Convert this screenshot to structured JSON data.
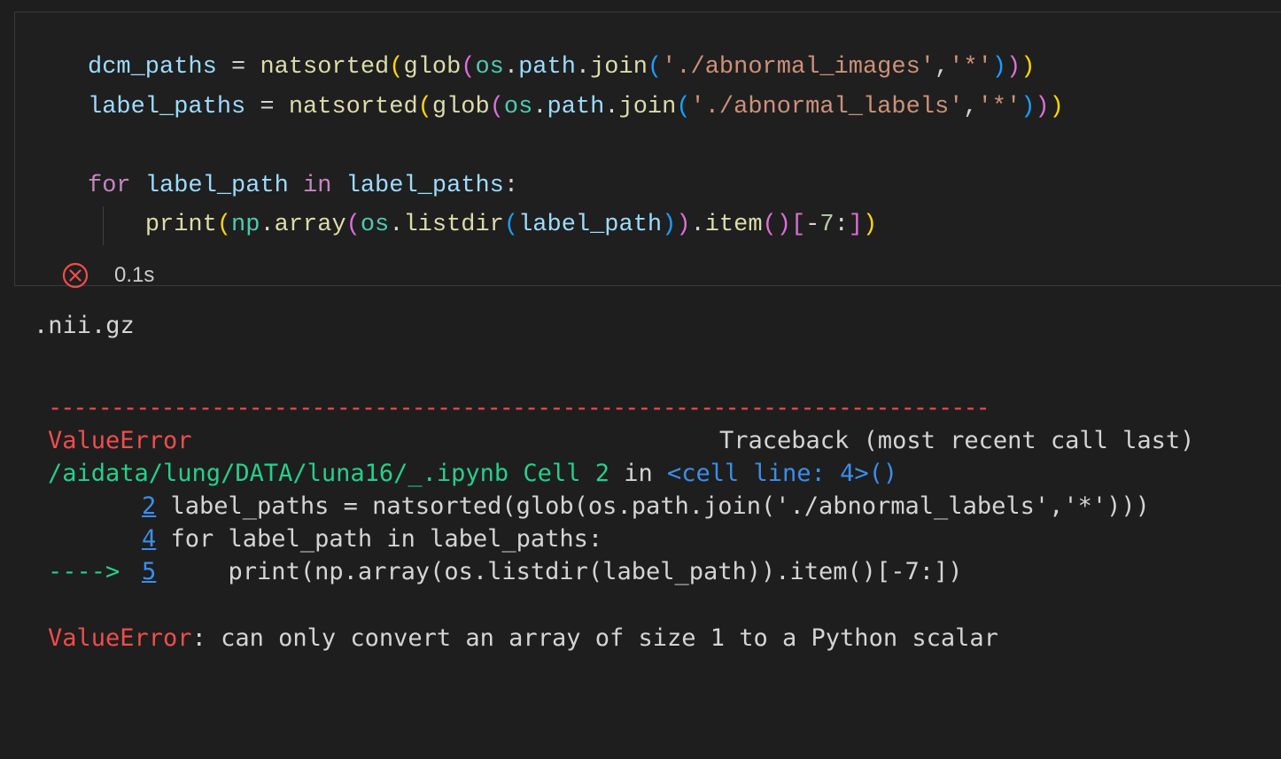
{
  "cell": {
    "code_lines": [
      {
        "tokens": [
          {
            "t": "dcm_paths",
            "c": "var"
          },
          {
            "t": " = ",
            "c": "op"
          },
          {
            "t": "natsorted",
            "c": "fn"
          },
          {
            "t": "(",
            "c": "b1"
          },
          {
            "t": "glob",
            "c": "fn"
          },
          {
            "t": "(",
            "c": "b2"
          },
          {
            "t": "os",
            "c": "mod"
          },
          {
            "t": ".",
            "c": "op"
          },
          {
            "t": "path",
            "c": "var"
          },
          {
            "t": ".",
            "c": "op"
          },
          {
            "t": "join",
            "c": "fn"
          },
          {
            "t": "(",
            "c": "b3"
          },
          {
            "t": "'./abnormal_images'",
            "c": "str"
          },
          {
            "t": ",",
            "c": "op"
          },
          {
            "t": "'*'",
            "c": "str"
          },
          {
            "t": ")",
            "c": "b3"
          },
          {
            "t": ")",
            "c": "b2"
          },
          {
            "t": ")",
            "c": "b1"
          }
        ]
      },
      {
        "tokens": [
          {
            "t": "label_paths",
            "c": "var"
          },
          {
            "t": " = ",
            "c": "op"
          },
          {
            "t": "natsorted",
            "c": "fn"
          },
          {
            "t": "(",
            "c": "b1"
          },
          {
            "t": "glob",
            "c": "fn"
          },
          {
            "t": "(",
            "c": "b2"
          },
          {
            "t": "os",
            "c": "mod"
          },
          {
            "t": ".",
            "c": "op"
          },
          {
            "t": "path",
            "c": "var"
          },
          {
            "t": ".",
            "c": "op"
          },
          {
            "t": "join",
            "c": "fn"
          },
          {
            "t": "(",
            "c": "b3"
          },
          {
            "t": "'./abnormal_labels'",
            "c": "str"
          },
          {
            "t": ",",
            "c": "op"
          },
          {
            "t": "'*'",
            "c": "str"
          },
          {
            "t": ")",
            "c": "b3"
          },
          {
            "t": ")",
            "c": "b2"
          },
          {
            "t": ")",
            "c": "b1"
          }
        ]
      },
      {
        "tokens": []
      },
      {
        "tokens": [
          {
            "t": "for",
            "c": "kw"
          },
          {
            "t": " ",
            "c": "op"
          },
          {
            "t": "label_path",
            "c": "var"
          },
          {
            "t": " ",
            "c": "op"
          },
          {
            "t": "in",
            "c": "kw"
          },
          {
            "t": " ",
            "c": "op"
          },
          {
            "t": "label_paths",
            "c": "var"
          },
          {
            "t": ":",
            "c": "op"
          }
        ]
      },
      {
        "tokens": [
          {
            "t": "    ",
            "c": "op"
          },
          {
            "t": "print",
            "c": "fn"
          },
          {
            "t": "(",
            "c": "b1"
          },
          {
            "t": "np",
            "c": "mod"
          },
          {
            "t": ".",
            "c": "op"
          },
          {
            "t": "array",
            "c": "fn"
          },
          {
            "t": "(",
            "c": "b2"
          },
          {
            "t": "os",
            "c": "mod"
          },
          {
            "t": ".",
            "c": "op"
          },
          {
            "t": "listdir",
            "c": "fn"
          },
          {
            "t": "(",
            "c": "b3"
          },
          {
            "t": "label_path",
            "c": "var"
          },
          {
            "t": ")",
            "c": "b3"
          },
          {
            "t": ")",
            "c": "b2"
          },
          {
            "t": ".",
            "c": "op"
          },
          {
            "t": "item",
            "c": "fn"
          },
          {
            "t": "(",
            "c": "b2"
          },
          {
            "t": ")",
            "c": "b2"
          },
          {
            "t": "[",
            "c": "b2"
          },
          {
            "t": "-",
            "c": "op"
          },
          {
            "t": "7",
            "c": "num"
          },
          {
            "t": ":",
            "c": "op"
          },
          {
            "t": "]",
            "c": "b2"
          },
          {
            "t": ")",
            "c": "b1"
          }
        ]
      }
    ],
    "status": {
      "icon": "error-circle-icon",
      "exec_time": "0.1s",
      "error_color": "#f14c4c"
    }
  },
  "output": {
    "stdout": ".nii.gz",
    "separator": "---------------------------------------------------------------------------",
    "error_type": "ValueError",
    "traceback_header": "Traceback (most recent call last)",
    "location": {
      "file": "/aidata/lung/DATA/luna16/_.ipynb Cell 2",
      "in_word": " in ",
      "cell_ref": "<cell line: 4>()"
    },
    "trace_lines": [
      {
        "arrow": "",
        "lineno": "2",
        "code": " label_paths = natsorted(glob(os.path.join('./abnormal_labels','*')))"
      },
      {
        "arrow": "",
        "lineno": "4",
        "code": " for label_path in label_paths:"
      },
      {
        "arrow": "---->",
        "lineno": "5",
        "code": "     print(np.array(os.listdir(label_path)).item()[-7:])"
      }
    ],
    "error_message": ": can only convert an array of size 1 to a Python scalar"
  }
}
